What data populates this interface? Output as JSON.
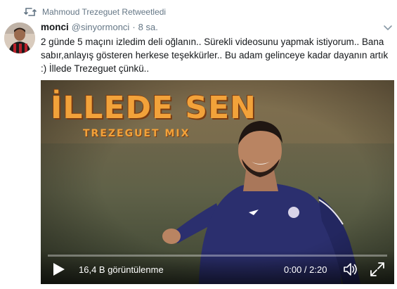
{
  "retweet": {
    "icon": "retweet-icon",
    "label": "Mahmoud Trezeguet Retweetledi"
  },
  "tweet": {
    "name": "monci",
    "handle": "@sinyormonci",
    "separator": "·",
    "time": "8 sa.",
    "text_line1": "2 günde 5 maçını izledim deli oğlanın.. Sürekli videosunu yapmak istiyorum.. Bana",
    "text_line2": "sabır,anlayış gösteren herkese teşekkürler.. Bu adam gelinceye kadar dayanın artık",
    "text_line3": ":) İllede Trezeguet çünkü.."
  },
  "video": {
    "overlay_title": "İLLEDE SEN",
    "overlay_subtitle": "TREZEGUET MIX",
    "views": "16,4 B görüntülenme",
    "time": "0:00 / 2:20",
    "progress": 0,
    "icons": {
      "play": "play-icon",
      "volume": "volume-icon",
      "fullscreen": "fullscreen-icon"
    }
  },
  "colors": {
    "text": "#14171a",
    "secondary": "#657786",
    "overlay_orange": "#f2a23a",
    "jersey": "#2b2f6e"
  }
}
